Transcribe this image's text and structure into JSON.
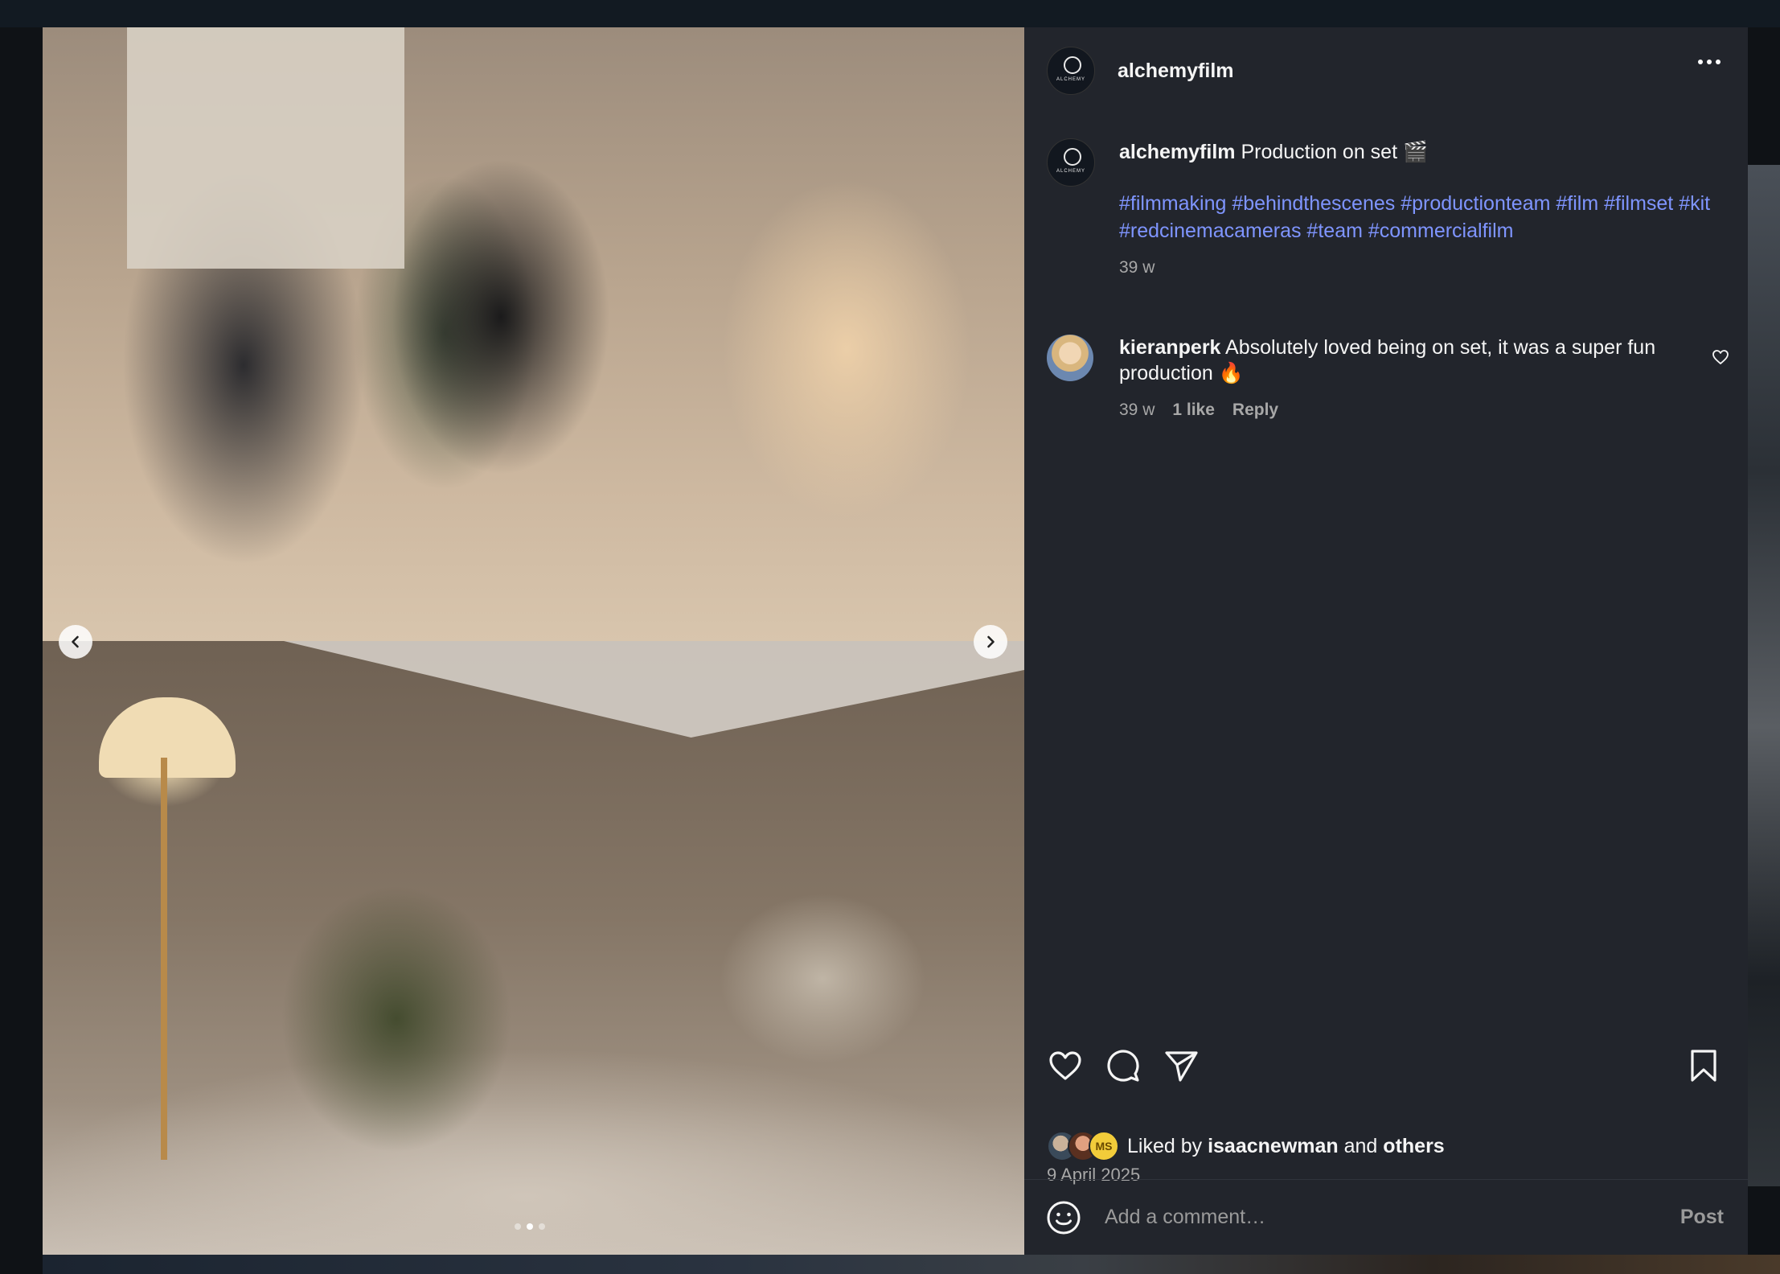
{
  "post": {
    "username": "alchemyfilm",
    "avatar_text": "ALCHEMY",
    "caption": {
      "username": "alchemyfilm",
      "text": "Production on set 🎬",
      "hashtags": "#filmmaking #behindthescenes #productionteam #film #filmset #kit #redcinemacameras #team #commercialfilm",
      "age": "39 w"
    },
    "comments": [
      {
        "username": "kieranperk",
        "text": "Absolutely loved being on set, it was a super fun production 🔥",
        "age": "39 w",
        "likes": "1 like",
        "reply_label": "Reply"
      }
    ],
    "likes": {
      "prefix": "Liked by",
      "user": "isaacnewman",
      "joiner": "and",
      "others": "others",
      "avatar_initials": "MS"
    },
    "date": "9 April 2025",
    "add_comment": {
      "placeholder": "Add a comment…",
      "post_label": "Post"
    },
    "carousel": {
      "total_slides": 3,
      "active_slide": 2
    },
    "icons": {
      "prev": "chevron-left-icon",
      "next": "chevron-right-icon",
      "more": "more-horizontal-icon",
      "like": "heart-icon",
      "comment": "comment-icon",
      "share": "send-icon",
      "save": "bookmark-icon",
      "emoji": "emoji-icon"
    }
  }
}
